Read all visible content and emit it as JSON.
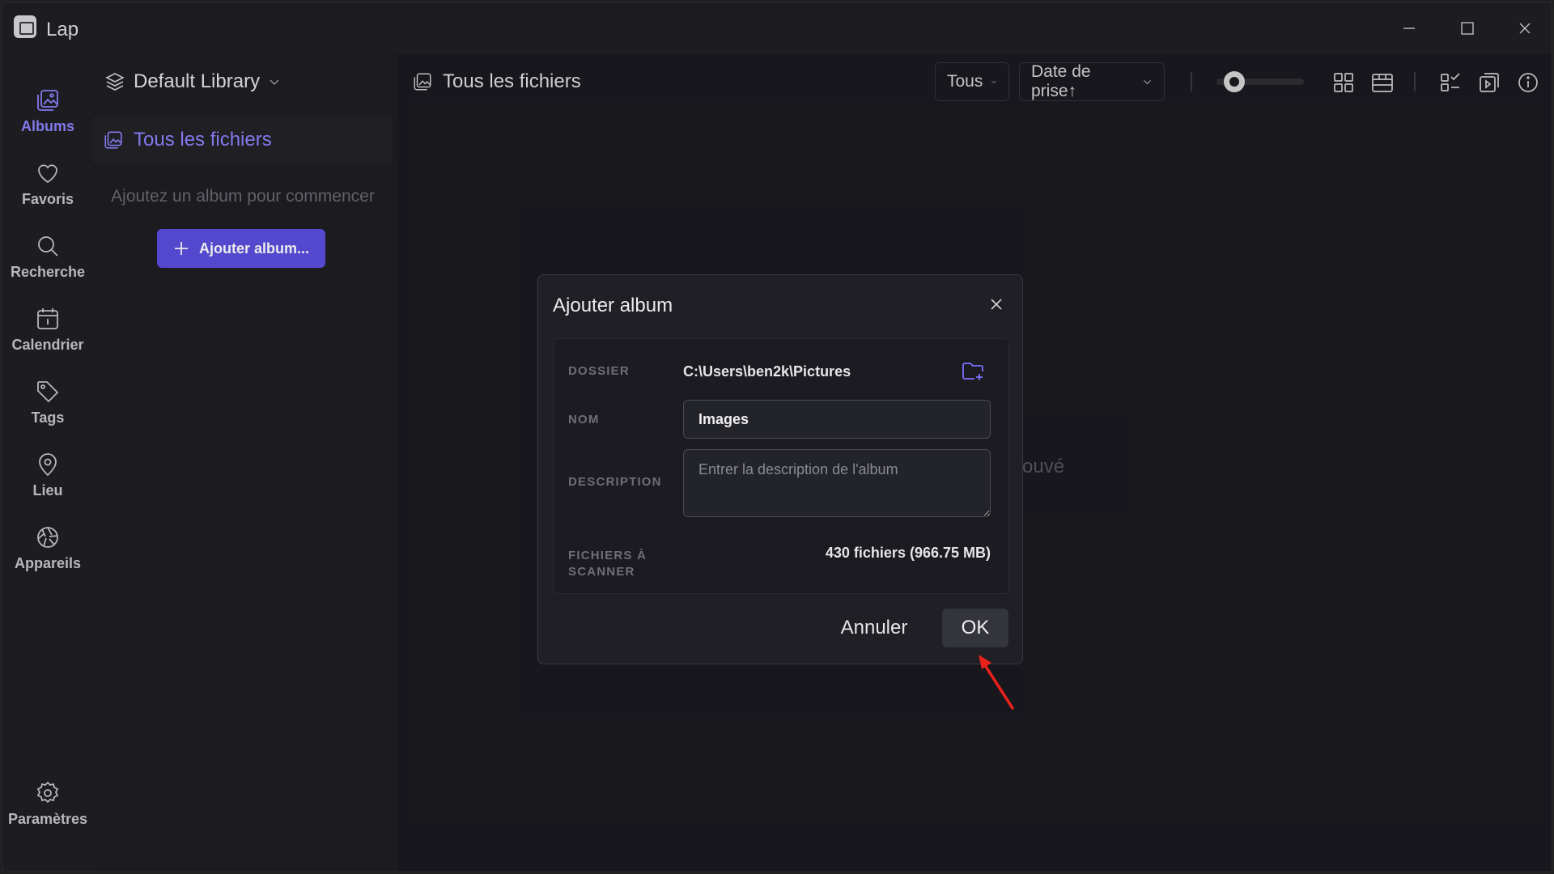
{
  "app": {
    "title": "Lap"
  },
  "rail": {
    "items": [
      {
        "label": "Albums",
        "icon": "albums-icon",
        "active": true
      },
      {
        "label": "Favoris",
        "icon": "heart-icon"
      },
      {
        "label": "Recherche",
        "icon": "search-icon"
      },
      {
        "label": "Calendrier",
        "icon": "calendar-icon"
      },
      {
        "label": "Tags",
        "icon": "tag-icon"
      },
      {
        "label": "Lieu",
        "icon": "location-icon"
      },
      {
        "label": "Appareils",
        "icon": "camera-aperture-icon"
      }
    ],
    "settings_label": "Paramètres"
  },
  "library": {
    "name": "Default Library",
    "all_files": "Tous les fichiers",
    "empty_hint": "Ajoutez un album pour commencer",
    "add_album_label": "Ajouter album..."
  },
  "main": {
    "title": "Tous les fichiers",
    "filter_value": "Tous",
    "sort_value": "Date de prise↑",
    "partial_text": "ouvé",
    "zoom_level": 0.2
  },
  "dialog": {
    "title": "Ajouter album",
    "folder_label": "DOSSIER",
    "folder_value": "C:\\Users\\ben2k\\Pictures",
    "name_label": "NOM",
    "name_value": "Images",
    "description_label": "DESCRIPTION",
    "description_placeholder": "Entrer la description de l'album",
    "files_label": "FICHIERS À SCANNER",
    "files_value": "430 fichiers (966.75 MB)",
    "cancel_label": "Annuler",
    "ok_label": "OK"
  },
  "colors": {
    "accent": "#8f84ff",
    "button_primary": "#5b4fe0",
    "annotation_arrow": "#e8221b"
  }
}
